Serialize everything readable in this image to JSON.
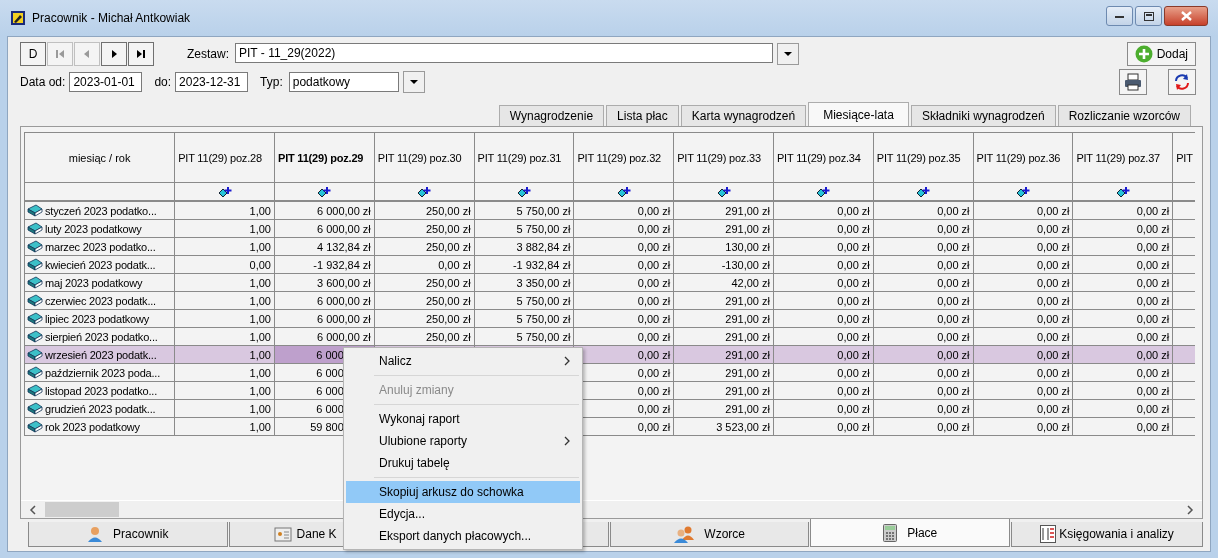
{
  "window": {
    "title": "Pracownik - Michał Antkowiak"
  },
  "nav_buttons": [
    {
      "kind": "new",
      "label": "D",
      "disabled": false
    },
    {
      "kind": "first",
      "disabled": true
    },
    {
      "kind": "prev",
      "disabled": true
    },
    {
      "kind": "next",
      "disabled": false
    },
    {
      "kind": "last",
      "disabled": false
    }
  ],
  "zestaw": {
    "label": "Zestaw:",
    "value": "PIT - 11_29(2022)"
  },
  "filters": {
    "from_label": "Data od:",
    "from": "2023-01-01",
    "to_label": "do:",
    "to": "2023-12-31",
    "type_label": "Typ:",
    "type": "podatkowy"
  },
  "add_button": "Dodaj",
  "tabs": [
    {
      "label": "Wynagrodzenie",
      "selected": false
    },
    {
      "label": "Lista płac",
      "selected": false
    },
    {
      "label": "Karta wynagrodzeń",
      "selected": false
    },
    {
      "label": "Miesiące-lata",
      "selected": true
    },
    {
      "label": "Składniki wynagrodzeń",
      "selected": false
    },
    {
      "label": "Rozliczanie wzorców",
      "selected": false
    }
  ],
  "table": {
    "columns": [
      {
        "label": "miesiąc / rok",
        "current": false
      },
      {
        "label": "PIT 11(29) poz.28",
        "current": false
      },
      {
        "label": "PIT 11(29) poz.29",
        "current": true
      },
      {
        "label": "PIT 11(29) poz.30",
        "current": false
      },
      {
        "label": "PIT 11(29) poz.31",
        "current": false
      },
      {
        "label": "PIT 11(29) poz.32",
        "current": false
      },
      {
        "label": "PIT 11(29) poz.33",
        "current": false
      },
      {
        "label": "PIT 11(29) poz.34",
        "current": false
      },
      {
        "label": "PIT 11(29) poz.35",
        "current": false
      },
      {
        "label": "PIT 11(29) poz.36",
        "current": false
      },
      {
        "label": "PIT 11(29) poz.37",
        "current": false
      },
      {
        "label": "PIT",
        "current": false
      }
    ],
    "rows": [
      {
        "selected": false,
        "cells": [
          "styczeń 2023 podatko...",
          "1,00",
          "6 000,00 zł",
          "250,00 zł",
          "5 750,00 zł",
          "0,00 zł",
          "291,00 zł",
          "0,00 zł",
          "0,00 zł",
          "0,00 zł",
          "0,00 zł"
        ]
      },
      {
        "selected": false,
        "cells": [
          "luty 2023 podatkowy",
          "1,00",
          "6 000,00 zł",
          "250,00 zł",
          "5 750,00 zł",
          "0,00 zł",
          "291,00 zł",
          "0,00 zł",
          "0,00 zł",
          "0,00 zł",
          "0,00 zł"
        ]
      },
      {
        "selected": false,
        "cells": [
          "marzec 2023 podatko...",
          "1,00",
          "4 132,84 zł",
          "250,00 zł",
          "3 882,84 zł",
          "0,00 zł",
          "130,00 zł",
          "0,00 zł",
          "0,00 zł",
          "0,00 zł",
          "0,00 zł"
        ]
      },
      {
        "selected": false,
        "cells": [
          "kwiecień 2023 podatk...",
          "0,00",
          "-1 932,84 zł",
          "0,00 zł",
          "-1 932,84 zł",
          "0,00 zł",
          "-130,00 zł",
          "0,00 zł",
          "0,00 zł",
          "0,00 zł",
          "0,00 zł"
        ]
      },
      {
        "selected": false,
        "cells": [
          "maj 2023 podatkowy",
          "1,00",
          "3 600,00 zł",
          "250,00 zł",
          "3 350,00 zł",
          "0,00 zł",
          "42,00 zł",
          "0,00 zł",
          "0,00 zł",
          "0,00 zł",
          "0,00 zł"
        ]
      },
      {
        "selected": false,
        "cells": [
          "czerwiec 2023 podatk...",
          "1,00",
          "6 000,00 zł",
          "250,00 zł",
          "5 750,00 zł",
          "0,00 zł",
          "291,00 zł",
          "0,00 zł",
          "0,00 zł",
          "0,00 zł",
          "0,00 zł"
        ]
      },
      {
        "selected": false,
        "cells": [
          "lipiec 2023 podatkowy",
          "1,00",
          "6 000,00 zł",
          "250,00 zł",
          "5 750,00 zł",
          "0,00 zł",
          "291,00 zł",
          "0,00 zł",
          "0,00 zł",
          "0,00 zł",
          "0,00 zł"
        ]
      },
      {
        "selected": false,
        "cells": [
          "sierpień 2023 podatko...",
          "1,00",
          "6 000,00 zł",
          "250,00 zł",
          "5 750,00 zł",
          "0,00 zł",
          "291,00 zł",
          "0,00 zł",
          "0,00 zł",
          "0,00 zł",
          "0,00 zł"
        ]
      },
      {
        "selected": true,
        "cells": [
          "wrzesień 2023 podatk...",
          "1,00",
          "6 000",
          null,
          null,
          "0,00 zł",
          "291,00 zł",
          "0,00 zł",
          "0,00 zł",
          "0,00 zł",
          "0,00 zł"
        ]
      },
      {
        "selected": false,
        "cells": [
          "październik 2023 poda...",
          "1,00",
          "6 000",
          null,
          null,
          "0,00 zł",
          "291,00 zł",
          "0,00 zł",
          "0,00 zł",
          "0,00 zł",
          "0,00 zł"
        ]
      },
      {
        "selected": false,
        "cells": [
          "listopad 2023 podatko...",
          "1,00",
          "6 000",
          null,
          null,
          "0,00 zł",
          "291,00 zł",
          "0,00 zł",
          "0,00 zł",
          "0,00 zł",
          "0,00 zł"
        ]
      },
      {
        "selected": false,
        "cells": [
          "grudzień 2023 podatk...",
          "1,00",
          "6 000",
          null,
          null,
          "0,00 zł",
          "291,00 zł",
          "0,00 zł",
          "0,00 zł",
          "0,00 zł",
          "0,00 zł"
        ]
      },
      {
        "selected": false,
        "cells": [
          "rok 2023 podatkowy",
          "1,00",
          "59 800",
          null,
          null,
          "0,00 zł",
          "3 523,00 zł",
          "0,00 zł",
          "0,00 zł",
          "0,00 zł",
          "0,00 zł"
        ]
      }
    ]
  },
  "bottom_tabs": [
    {
      "label": "Pracownik",
      "kind": "person",
      "selected": false
    },
    {
      "label": "Dane K",
      "kind": "card",
      "selected": false
    },
    {
      "label": "Wzorce",
      "kind": "people",
      "selected": false
    },
    {
      "label": "Płace",
      "kind": "calculator",
      "selected": true
    },
    {
      "label": "Księgowania i analizy",
      "kind": "ledger",
      "selected": false
    }
  ],
  "context_menu": [
    {
      "kind": "item",
      "label": "Nalicz",
      "submenu": true,
      "disabled": false,
      "selected": false
    },
    {
      "kind": "separator"
    },
    {
      "kind": "item",
      "label": "Anuluj zmiany",
      "submenu": false,
      "disabled": true,
      "selected": false
    },
    {
      "kind": "separator"
    },
    {
      "kind": "item",
      "label": "Wykonaj raport",
      "submenu": false,
      "disabled": false,
      "selected": false
    },
    {
      "kind": "item",
      "label": "Ulubione raporty",
      "submenu": true,
      "disabled": false,
      "selected": false
    },
    {
      "kind": "item",
      "label": "Drukuj tabelę",
      "submenu": false,
      "disabled": false,
      "selected": false
    },
    {
      "kind": "separator"
    },
    {
      "kind": "item",
      "label": "Skopiuj arkusz do schowka",
      "submenu": false,
      "disabled": false,
      "selected": true
    },
    {
      "kind": "item",
      "label": "Edycja...",
      "submenu": false,
      "disabled": false,
      "selected": false
    },
    {
      "kind": "item",
      "label": "Eksport danych płacowych...",
      "submenu": false,
      "disabled": false,
      "selected": false
    }
  ]
}
